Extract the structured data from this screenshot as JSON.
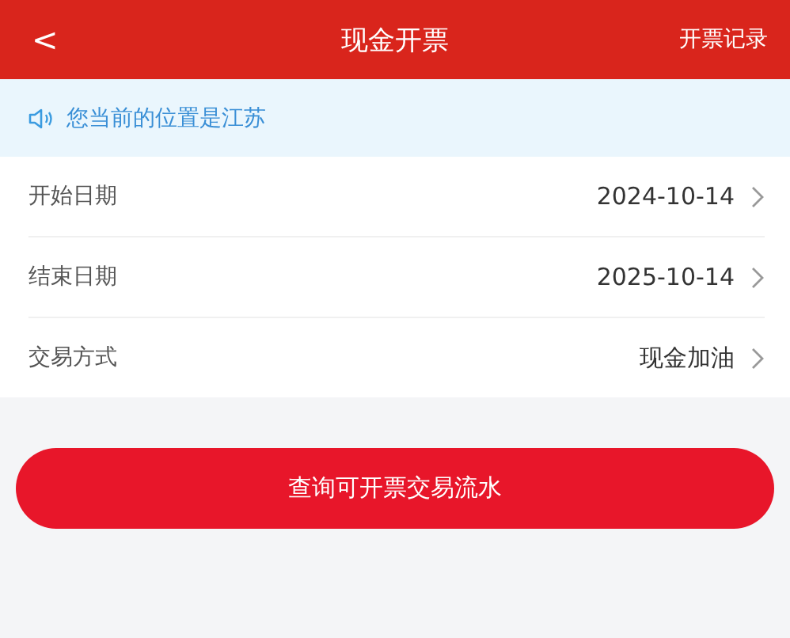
{
  "header": {
    "back": "<",
    "title": "现金开票",
    "action": "开票记录"
  },
  "notice": {
    "text": "您当前的位置是江苏"
  },
  "rows": [
    {
      "label": "开始日期",
      "value": "2024-10-14"
    },
    {
      "label": "结束日期",
      "value": "2025-10-14"
    },
    {
      "label": "交易方式",
      "value": "现金加油"
    }
  ],
  "button": "查询可开票交易流水"
}
